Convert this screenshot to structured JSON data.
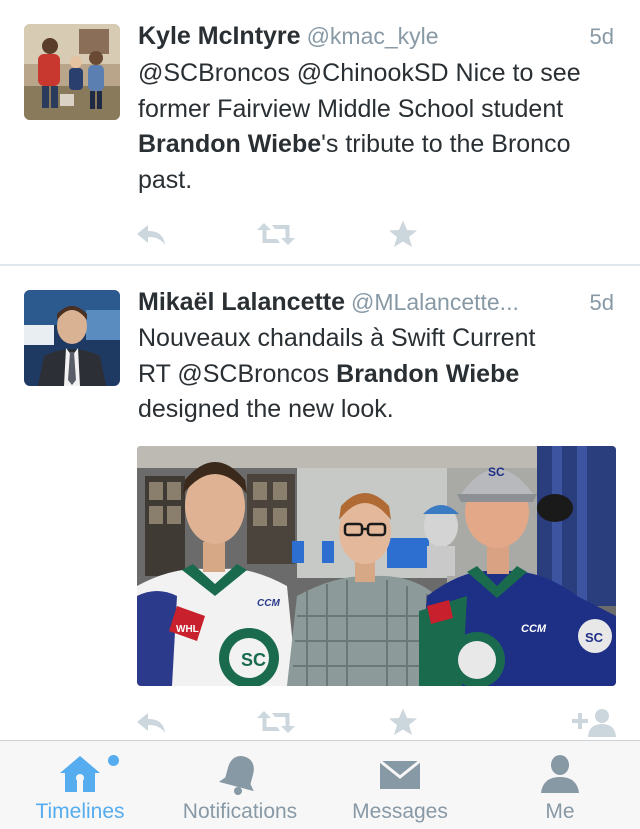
{
  "colors": {
    "accent": "#55acee",
    "secondary_text": "#8899a6",
    "primary_text": "#292f33",
    "action_icon": "#ccd6dd"
  },
  "tweets": [
    {
      "name": "Kyle McIntyre",
      "handle": "@kmac_kyle",
      "time": "5d",
      "text_segments": [
        "@SCBroncos @ChinookSD Nice to see former Fairview Middle School student ",
        "Brandon Wiebe",
        "'s tribute to the Bronco past."
      ],
      "actions": [
        "reply-icon",
        "retweet-icon",
        "favorite-icon"
      ]
    },
    {
      "name": "Mikaël Lalancette",
      "handle": "@MLalancette...",
      "time": "5d",
      "text_line1": "Nouveaux chandails à Swift Current",
      "text_segments": [
        "RT @SCBroncos ",
        "Brandon Wiebe",
        "designed the new look."
      ],
      "photo_text": {
        "hat_logo": "SC",
        "jersey_logo": "SC",
        "jersey_brand": "CCM",
        "patch": "WHL"
      },
      "actions": [
        "reply-icon",
        "retweet-icon",
        "favorite-icon",
        "follow-icon"
      ]
    }
  ],
  "tabbar": {
    "active": "Timelines",
    "tabs": [
      {
        "label": "Timelines",
        "icon": "home-icon",
        "has_dot": true
      },
      {
        "label": "Notifications",
        "icon": "bell-icon",
        "has_dot": false
      },
      {
        "label": "Messages",
        "icon": "envelope-icon",
        "has_dot": false
      },
      {
        "label": "Me",
        "icon": "person-icon",
        "has_dot": false
      }
    ]
  }
}
